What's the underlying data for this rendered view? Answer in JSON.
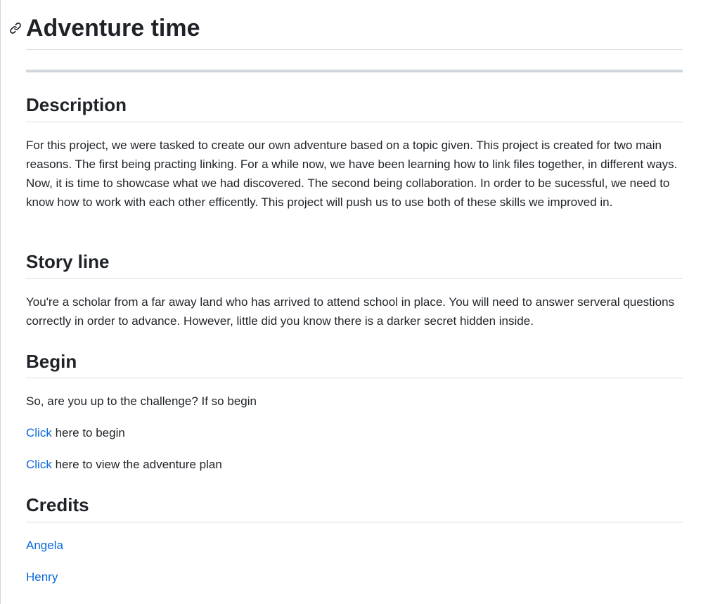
{
  "page": {
    "title": "Adventure time"
  },
  "sections": {
    "description": {
      "heading": "Description",
      "body": "For this project, we were tasked to create our own adventure based on a topic given. This project is created for two main reasons. The first being practing linking. For a while now, we have been learning how to link files together, in different ways. Now, it is time to showcase what we had discovered. The second being collaboration. In order to be sucessful, we need to know how to work with each other efficently. This project will push us to use both of these skills we improved in."
    },
    "storyline": {
      "heading": "Story line",
      "body": "You're a scholar from a far away land who has arrived to attend school in place. You will need to answer serveral questions correctly in order to advance. However, little did you know there is a darker secret hidden inside."
    },
    "begin": {
      "heading": "Begin",
      "intro": "So, are you up to the challenge? If so begin",
      "link1_label": "Click",
      "link1_rest": " here to begin",
      "link2_label": "Click",
      "link2_rest": " here to view the adventure plan"
    },
    "credits": {
      "heading": "Credits",
      "people": [
        "Angela",
        "Henry"
      ]
    }
  },
  "colors": {
    "link": "#0969da",
    "text": "#1f2328",
    "border": "#d8dee4"
  },
  "icons": {
    "anchor": "link-icon"
  }
}
